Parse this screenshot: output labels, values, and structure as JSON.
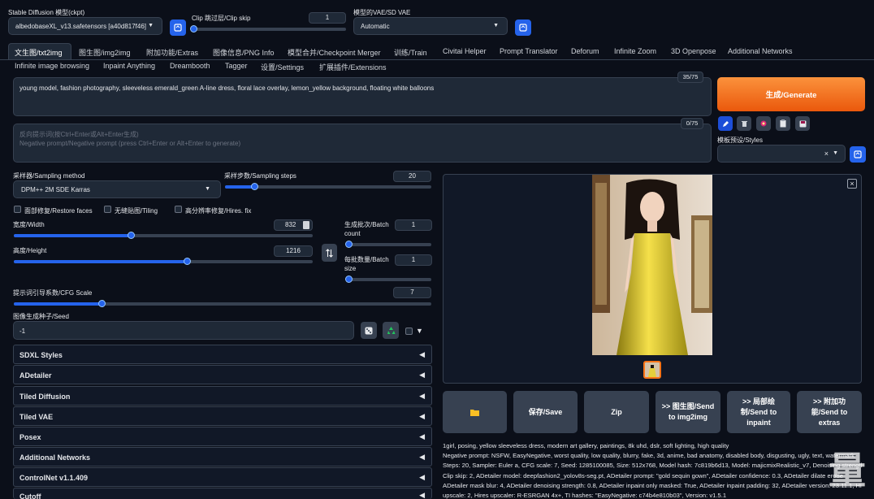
{
  "colors": {
    "accent": "#2563eb",
    "generate": "#f97316",
    "bg": "#0b0f19",
    "panel": "#1f2937"
  },
  "top": {
    "ckpt_label": "Stable Diffusion 模型(ckpt)",
    "ckpt_value": "albedobaseXL_v13.safetensors [a40d817f46]",
    "clip_label": "Clip 跳过层/Clip skip",
    "clip_value": "1",
    "clip_fraction": 0.0,
    "vae_label": "模型的VAE/SD VAE",
    "vae_value": "Automatic"
  },
  "tabs_row1": [
    "文生图/txt2img",
    "图生图/img2img",
    "附加功能/Extras",
    "图像信息/PNG Info",
    "模型合并/Checkpoint Merger",
    "训练/Train",
    "Civitai Helper",
    "Prompt Translator",
    "Deforum",
    "Infinite Zoom",
    "3D Openpose",
    "Additional Networks"
  ],
  "tabs_row2": [
    "Infinite image browsing",
    "Inpaint Anything",
    "Dreambooth",
    "Tagger",
    "设置/Settings",
    "扩展插件/Extensions"
  ],
  "prompt": {
    "text": "young model, fashion photography, sleeveless emerald_green A-line dress, floral lace overlay, lemon_yellow background, floating white balloons",
    "counter": "35/75",
    "neg_placeholder_cn": "反向提示词(按Ctrl+Enter或Alt+Enter生成)",
    "neg_placeholder_en": "Negative prompt/Negative prompt (press Ctrl+Enter or Alt+Enter to generate)",
    "neg_counter": "0/75"
  },
  "generate_label": "生成/Generate",
  "styles_label": "模板预设/Styles",
  "sampling": {
    "method_label": "采样器/Sampling method",
    "method_value": "DPM++ 2M SDE Karras",
    "steps_label": "采样步数/Sampling steps",
    "steps_value": "20",
    "steps_fraction": 0.14
  },
  "checks": {
    "restore": "面部修复/Restore faces",
    "tiling": "无缝贴图/Tiling",
    "hires": "高分辨率修复/Hires. fix"
  },
  "width": {
    "label": "宽度/Width",
    "value": "832",
    "fraction": 0.39
  },
  "height": {
    "label": "高度/Height",
    "value": "1216",
    "fraction": 0.58
  },
  "batch_count": {
    "label": "生成批次/Batch count",
    "value": "1",
    "fraction": 0.0
  },
  "batch_size": {
    "label": "每批数量/Batch size",
    "value": "1",
    "fraction": 0.0
  },
  "cfg": {
    "label": "提示词引导系数/CFG Scale",
    "value": "7",
    "fraction": 0.21
  },
  "seed": {
    "label": "图像生成种子/Seed",
    "value": "-1"
  },
  "accordions": [
    "SDXL Styles",
    "ADetailer",
    "Tiled Diffusion",
    "Tiled VAE",
    "Posex",
    "Additional Networks",
    "ControlNet v1.1.409",
    "Cutoff"
  ],
  "actions": {
    "folder": "folder-icon",
    "save": "保存/Save",
    "zip": "Zip",
    "img2img": ">> 图生图/Send to img2img",
    "inpaint": ">> 局部绘制/Send to inpaint",
    "extras": ">> 附加功能/Send to extras"
  },
  "info": {
    "line1": "1girl, posing, yellow sleeveless dress, modern art gallery, paintings, 8k uhd, dslr, soft lighting, high quality",
    "line2": "Negative prompt: NSFW, EasyNegative, worst quality, low quality, blurry, fake, 3d, anime, bad anatomy, disabled body, disgusting, ugly, text, watermark",
    "line3": "Steps: 20, Sampler: Euler a, CFG scale: 7, Seed: 1285100085, Size: 512x768, Model hash: 7c819b6d13, Model: majicmixRealistic_v7, Denoising strength",
    "line4": "Clip skip: 2, ADetailer model: deepfashion2_yolov8s-seg.pt, ADetailer prompt: \"gold sequin gown\", ADetailer confidence: 0.3, ADetailer dilate erode",
    "line5": "ADetailer mask blur: 4, ADetailer denoising strength: 0.8, ADetailer inpaint only masked: True, ADetailer inpaint padding: 32, ADetailer version: 23.11.1, Hires",
    "line6": "upscale: 2, Hires upscaler: R-ESRGAN 4x+, TI hashes: \"EasyNegative: c74b4e810b03\", Version: v1.5.1"
  },
  "watermark": "量"
}
